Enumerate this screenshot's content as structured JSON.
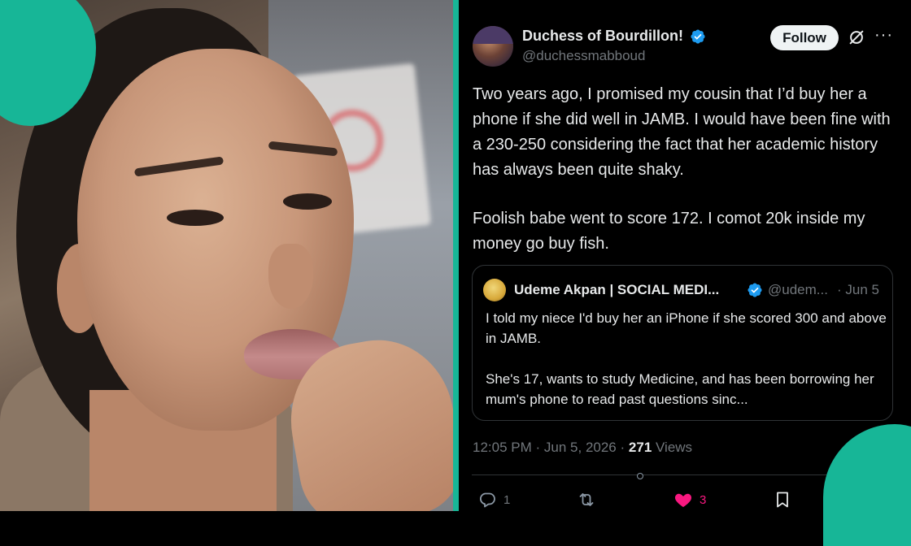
{
  "tweet": {
    "author_name": "Duchess of Bourdillon!",
    "author_handle": "@duchessmabboud",
    "follow_label": "Follow",
    "more_label": "···",
    "paragraphs": [
      "Two years ago, I promised my cousin that I’d buy her a phone if she did well in JAMB. I would have been fine with a 230-250 considering the fact that her academic history has always been quite shaky.",
      "Foolish babe went to score 172. I comot 20k inside my money go buy fish."
    ],
    "time": "12:05 PM",
    "date": "Jun 5, 2026",
    "views_count": "271",
    "views_label": "Views",
    "sep_dot": "·",
    "replies": "1",
    "retweets": "",
    "likes": "3"
  },
  "quoted": {
    "author_name": "Udeme Akpan | SOCIAL MEDI...",
    "author_handle": "@udem...",
    "date": "· Jun 5",
    "paragraphs": [
      "I told my niece I'd buy her an iPhone if she scored 300 and above in JAMB.",
      "She's 17, wants to study Medicine, and has been borrowing her mum's phone to read past questions sinc..."
    ]
  },
  "colors": {
    "accent_teal": "#17b697",
    "verified_blue": "#1d9bf0",
    "like_pink": "#f91880",
    "text_primary": "#e7e9ea",
    "text_secondary": "#71767b"
  },
  "icons": {
    "verified": "verified-badge-icon",
    "grok": "grok-icon",
    "more": "more-icon",
    "reply": "reply-icon",
    "retweet": "retweet-icon",
    "like": "heart-icon",
    "bookmark": "bookmark-icon"
  }
}
